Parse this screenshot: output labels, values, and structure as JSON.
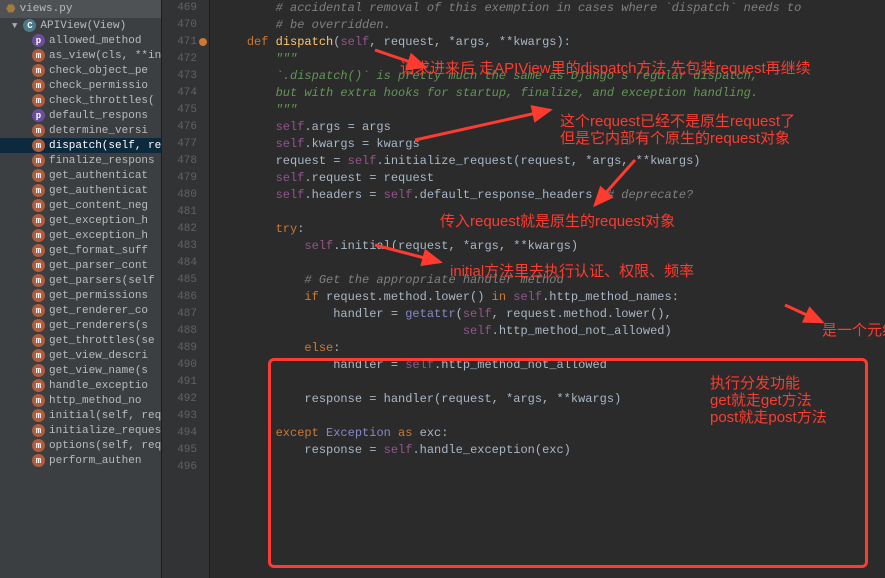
{
  "file_tab": "views.py",
  "sidebar": {
    "root": "APIView(View)",
    "items": [
      {
        "icon": "p",
        "label": "allowed_method"
      },
      {
        "icon": "m",
        "label": "as_view(cls, **in"
      },
      {
        "icon": "m",
        "label": "check_object_pe"
      },
      {
        "icon": "m",
        "label": "check_permissio"
      },
      {
        "icon": "m",
        "label": "check_throttles("
      },
      {
        "icon": "p",
        "label": "default_respons"
      },
      {
        "icon": "m",
        "label": "determine_versi"
      },
      {
        "icon": "m",
        "label": "dispatch(self, re",
        "selected": true
      },
      {
        "icon": "m",
        "label": "finalize_respons"
      },
      {
        "icon": "m",
        "label": "get_authenticat"
      },
      {
        "icon": "m",
        "label": "get_authenticat"
      },
      {
        "icon": "m",
        "label": "get_content_neg"
      },
      {
        "icon": "m",
        "label": "get_exception_h"
      },
      {
        "icon": "m",
        "label": "get_exception_h"
      },
      {
        "icon": "m",
        "label": "get_format_suff"
      },
      {
        "icon": "m",
        "label": "get_parser_cont"
      },
      {
        "icon": "m",
        "label": "get_parsers(self"
      },
      {
        "icon": "m",
        "label": "get_permissions"
      },
      {
        "icon": "m",
        "label": "get_renderer_co"
      },
      {
        "icon": "m",
        "label": "get_renderers(s"
      },
      {
        "icon": "m",
        "label": "get_throttles(se"
      },
      {
        "icon": "m",
        "label": "get_view_descri"
      },
      {
        "icon": "m",
        "label": "get_view_name(s"
      },
      {
        "icon": "m",
        "label": "handle_exceptio"
      },
      {
        "icon": "m",
        "label": "http_method_no"
      },
      {
        "icon": "m",
        "label": "initial(self, requ"
      },
      {
        "icon": "m",
        "label": "initialize_reques"
      },
      {
        "icon": "m",
        "label": "options(self, req"
      },
      {
        "icon": "m",
        "label": "perform_authen"
      }
    ]
  },
  "gutter": {
    "start": 469,
    "end": 496
  },
  "code": {
    "lines": [
      {
        "n": 469,
        "c": "        <span class='cmt'># accidental removal of this exemption in cases where `dispatch` needs to</span>"
      },
      {
        "n": 470,
        "c": "        <span class='cmt'># be overridden.</span>"
      },
      {
        "n": 471,
        "c": "    <span class='kw'>def</span> <span class='fn'>dispatch</span>(<span class='slf'>self</span>, request, *args, **kwargs):"
      },
      {
        "n": 472,
        "c": "        <span class='str'>\"\"\"</span>"
      },
      {
        "n": 473,
        "c": "<span class='str'>        `.dispatch()` is pretty much the same as Django's regular dispatch,</span>"
      },
      {
        "n": 474,
        "c": "<span class='str'>        but with extra hooks for startup, finalize, and exception handling.</span>"
      },
      {
        "n": 475,
        "c": "<span class='str'>        \"\"\"</span>"
      },
      {
        "n": 476,
        "c": "        <span class='slf'>self</span>.args = args"
      },
      {
        "n": 477,
        "c": "        <span class='slf'>self</span>.kwargs = kwargs"
      },
      {
        "n": 478,
        "c": "        request = <span class='slf'>self</span>.initialize_request(request, *args, **kwargs)"
      },
      {
        "n": 479,
        "c": "        <span class='slf'>self</span>.request = request"
      },
      {
        "n": 480,
        "c": "        <span class='slf'>self</span>.headers = <span class='slf'>self</span>.default_response_headers  <span class='cmt'># deprecate?</span>"
      },
      {
        "n": 481,
        "c": ""
      },
      {
        "n": 482,
        "c": "        <span class='kw'>try</span>:"
      },
      {
        "n": 483,
        "c": "            <span class='slf'>self</span>.initial(request, *args, **kwargs)"
      },
      {
        "n": 484,
        "c": ""
      },
      {
        "n": 485,
        "c": "            <span class='cmt'># Get the appropriate handler method</span>"
      },
      {
        "n": 486,
        "c": "            <span class='kw'>if</span> request.method.lower() <span class='kw'>in</span> <span class='slf'>self</span>.http_method_names:"
      },
      {
        "n": 487,
        "c": "                handler = <span class='bif'>getattr</span>(<span class='slf'>self</span>, request.method.lower(),"
      },
      {
        "n": 488,
        "c": "                                  <span class='slf'>self</span>.http_method_not_allowed)"
      },
      {
        "n": 489,
        "c": "            <span class='kw'>else</span>:"
      },
      {
        "n": 490,
        "c": "                handler = <span class='slf'>self</span>.http_method_not_allowed"
      },
      {
        "n": 491,
        "c": ""
      },
      {
        "n": 492,
        "c": "            response = handler(request, *args, **kwargs)"
      },
      {
        "n": 493,
        "c": ""
      },
      {
        "n": 494,
        "c": "        <span class='kw'>except</span> <span class='bif'>Exception</span> <span class='kw'>as</span> exc:"
      },
      {
        "n": 495,
        "c": "            response = <span class='slf'>self</span>.handle_exception(exc)"
      },
      {
        "n": 496,
        "c": ""
      }
    ]
  },
  "annotations": {
    "a1": "请求进来后 走APIView里的dispatch方法 先包装request再继续",
    "a2": "这个request已经不是原生request了\n但是它内部有个原生的request对象",
    "a3": "传入request就是原生的request对象",
    "a4": "initial方法里去执行认证、权限、频率",
    "a5": "是一个元组",
    "a6": "执行分发功能\nget就走get方法\npost就走post方法"
  }
}
